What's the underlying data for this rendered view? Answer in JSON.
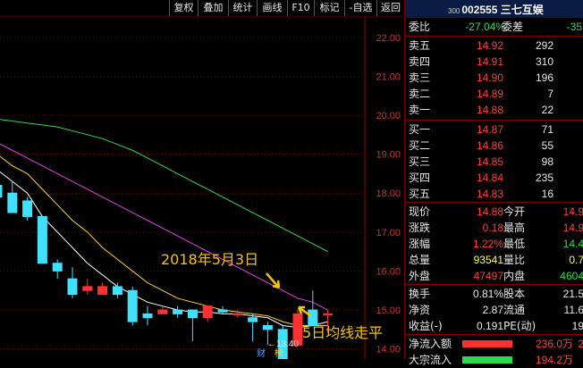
{
  "toolbar": [
    "复权",
    "叠加",
    "统计",
    "画线",
    "F10",
    "标记",
    "-自选",
    "返回"
  ],
  "header": {
    "prefix": "300",
    "code_name": "002555 三七互娱"
  },
  "weibi": {
    "label1": "委比",
    "value1": "-27.04%",
    "label2": "委差",
    "value2": "-35"
  },
  "asks": [
    {
      "label": "卖五",
      "price": "14.92",
      "vol": "292"
    },
    {
      "label": "卖四",
      "price": "14.91",
      "vol": "310"
    },
    {
      "label": "卖三",
      "price": "14.90",
      "vol": "196"
    },
    {
      "label": "卖二",
      "price": "14.89",
      "vol": "7"
    },
    {
      "label": "卖一",
      "price": "14.88",
      "vol": "22"
    }
  ],
  "bids": [
    {
      "label": "买一",
      "price": "14.87",
      "vol": "71"
    },
    {
      "label": "买二",
      "price": "14.86",
      "vol": "55"
    },
    {
      "label": "买三",
      "price": "14.85",
      "vol": "98"
    },
    {
      "label": "买四",
      "price": "14.84",
      "vol": "235"
    },
    {
      "label": "买五",
      "price": "14.83",
      "vol": "16"
    }
  ],
  "stats": [
    {
      "l1": "现价",
      "v1": "14.88",
      "c1": "red",
      "l2": "今开",
      "v2": "14.9",
      "c2": "red"
    },
    {
      "l1": "涨跌",
      "v1": "0.18",
      "c1": "red",
      "l2": "最高",
      "v2": "14.9",
      "c2": "red"
    },
    {
      "l1": "涨幅",
      "v1": "1.22%",
      "c1": "red",
      "l2": "最低",
      "v2": "14.4",
      "c2": "grn"
    },
    {
      "l1": "总量",
      "v1": "93541",
      "c1": "yel",
      "l2": "量比",
      "v2": "0.7",
      "c2": "yel"
    },
    {
      "l1": "外盘",
      "v1": "47497",
      "c1": "red",
      "l2": "内盘",
      "v2": "4604",
      "c2": "grn"
    }
  ],
  "stats2": [
    {
      "l1": "换手",
      "v1": "0.81%",
      "l2": "股本",
      "v2": "21.5"
    },
    {
      "l1": "净资",
      "v1": "2.87",
      "l2": "流通",
      "v2": "11.6"
    },
    {
      "l1": "收益(-)",
      "v1": "0.191",
      "l2": "PE(动)",
      "v2": "19"
    }
  ],
  "flows": [
    {
      "label": "净流入额",
      "value": "236.0万",
      "extra": "2"
    },
    {
      "label": "大宗流入",
      "value": "194.2万",
      "extra": ""
    }
  ],
  "annotations": {
    "date": "2018年5月3日",
    "ma_note": "5日均线走平",
    "low_label": "←13.40",
    "tag1": "财",
    "tag2": "榜"
  },
  "chart_data": {
    "type": "candlestick",
    "ylim": [
      13.9,
      22.5
    ],
    "yticks": [
      "22.00",
      "21.00",
      "20.00",
      "19.00",
      "18.00",
      "17.00",
      "16.00",
      "15.00",
      "14.00"
    ],
    "candles": [
      {
        "o": 18.2,
        "c": 17.9,
        "h": 18.3,
        "l": 17.8
      },
      {
        "o": 18.0,
        "c": 17.5,
        "h": 18.3,
        "l": 17.5
      },
      {
        "o": 17.8,
        "c": 17.4,
        "h": 17.9,
        "l": 17.3
      },
      {
        "o": 17.4,
        "c": 16.2,
        "h": 17.4,
        "l": 16.2
      },
      {
        "o": 16.2,
        "c": 16.0,
        "h": 16.3,
        "l": 15.8
      },
      {
        "o": 15.8,
        "c": 15.4,
        "h": 16.1,
        "l": 15.3
      },
      {
        "o": 15.5,
        "c": 15.6,
        "h": 15.8,
        "l": 15.4
      },
      {
        "o": 15.4,
        "c": 15.6,
        "h": 15.7,
        "l": 15.4
      },
      {
        "o": 15.6,
        "c": 15.4,
        "h": 15.7,
        "l": 15.3
      },
      {
        "o": 15.5,
        "c": 14.7,
        "h": 15.6,
        "l": 14.6
      },
      {
        "o": 14.9,
        "c": 14.8,
        "h": 15.1,
        "l": 14.6
      },
      {
        "o": 14.9,
        "c": 15.0,
        "h": 15.1,
        "l": 14.9
      },
      {
        "o": 15.0,
        "c": 14.9,
        "h": 15.1,
        "l": 14.8
      },
      {
        "o": 15.0,
        "c": 14.8,
        "h": 15.0,
        "l": 14.2
      },
      {
        "o": 14.8,
        "c": 15.1,
        "h": 15.1,
        "l": 14.7
      },
      {
        "o": 15.0,
        "c": 14.95,
        "h": 15.1,
        "l": 14.9
      },
      {
        "o": 14.9,
        "c": 14.9,
        "h": 15.0,
        "l": 14.8
      },
      {
        "o": 14.8,
        "c": 14.7,
        "h": 14.9,
        "l": 14.2
      },
      {
        "o": 14.6,
        "c": 14.5,
        "h": 14.7,
        "l": 14.1
      },
      {
        "o": 14.5,
        "c": 13.7,
        "h": 14.6,
        "l": 13.4
      },
      {
        "o": 14.1,
        "c": 14.9,
        "h": 15.0,
        "l": 14.1
      },
      {
        "o": 15.0,
        "c": 14.6,
        "h": 15.5,
        "l": 14.6
      },
      {
        "o": 14.9,
        "c": 14.9,
        "h": 15.0,
        "l": 14.4
      }
    ],
    "ma_lines": [
      {
        "color": "#ffffff",
        "values": [
          18.6,
          18.3,
          18.0,
          17.4,
          17.0,
          16.6,
          16.2,
          15.9,
          15.6,
          15.4,
          15.2,
          15.1,
          15.0,
          14.95,
          14.95,
          14.9,
          14.9,
          14.85,
          14.8,
          14.6,
          14.55,
          14.6,
          14.7
        ]
      },
      {
        "color": "#ffd21e",
        "values": [
          19.0,
          18.7,
          18.5,
          18.1,
          17.7,
          17.3,
          17.0,
          16.6,
          16.3,
          16.0,
          15.7,
          15.5,
          15.3,
          15.2,
          15.1,
          15.0,
          14.95,
          14.9,
          14.85,
          14.7,
          14.6,
          14.6,
          14.6
        ]
      },
      {
        "color": "#e040e0",
        "values": [
          19.3,
          19.1,
          18.9,
          18.7,
          18.5,
          18.3,
          18.1,
          17.9,
          17.7,
          17.5,
          17.3,
          17.1,
          16.9,
          16.7,
          16.5,
          16.3,
          16.1,
          15.9,
          15.7,
          15.5,
          15.3,
          15.2,
          15.0
        ]
      },
      {
        "color": "#2fd84a",
        "values": [
          19.9,
          19.85,
          19.8,
          19.75,
          19.7,
          19.6,
          19.5,
          19.4,
          19.25,
          19.1,
          18.9,
          18.7,
          18.5,
          18.3,
          18.1,
          17.9,
          17.7,
          17.5,
          17.3,
          17.1,
          16.9,
          16.7,
          16.5
        ]
      }
    ]
  }
}
